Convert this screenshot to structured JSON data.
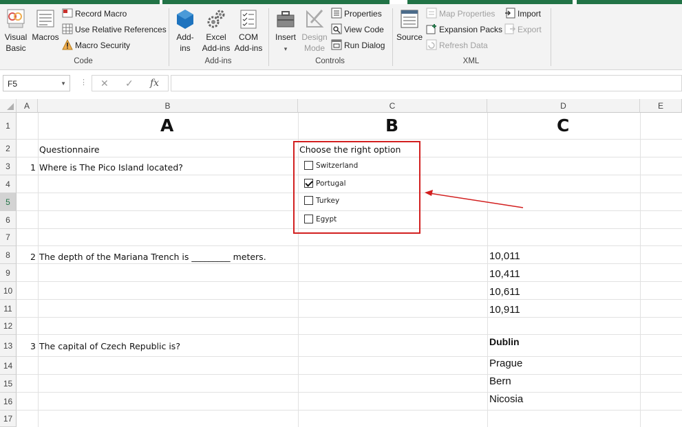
{
  "ribbon": {
    "code": {
      "group_label": "Code",
      "visual_basic_line1": "Visual",
      "visual_basic_line2": "Basic",
      "macros": "Macros",
      "record_macro": "Record Macro",
      "use_relative_references": "Use Relative References",
      "macro_security": "Macro Security"
    },
    "addins": {
      "group_label": "Add-ins",
      "addins_line1": "Add-",
      "addins_line2": "ins",
      "excel_addins_line1": "Excel",
      "excel_addins_line2": "Add-ins",
      "com_addins_line1": "COM",
      "com_addins_line2": "Add-ins"
    },
    "controls": {
      "group_label": "Controls",
      "insert": "Insert",
      "design_mode_line1": "Design",
      "design_mode_line2": "Mode",
      "properties": "Properties",
      "view_code": "View Code",
      "run_dialog": "Run Dialog"
    },
    "xml": {
      "group_label": "XML",
      "source": "Source",
      "map_properties": "Map Properties",
      "expansion_packs": "Expansion Packs",
      "refresh_data": "Refresh Data",
      "import": "Import",
      "export": "Export"
    }
  },
  "formula_bar": {
    "name_box": "F5",
    "formula": ""
  },
  "columns": [
    "A",
    "B",
    "C",
    "D",
    "E"
  ],
  "rows": [
    "1",
    "2",
    "3",
    "4",
    "5",
    "6",
    "7",
    "8",
    "9",
    "10",
    "11",
    "12",
    "13",
    "14",
    "15",
    "16",
    "17"
  ],
  "selected_row": "5",
  "sheet": {
    "header_a": "A",
    "header_b": "B",
    "header_c": "C",
    "questionnaire": "Questionnaire",
    "q1_num": "1",
    "q1_text": "Where is The Pico Island located?",
    "choose_option": "Choose the right option",
    "options": [
      {
        "label": "Switzerland",
        "checked": false
      },
      {
        "label": "Portugal",
        "checked": true
      },
      {
        "label": "Turkey",
        "checked": false
      },
      {
        "label": "Egypt",
        "checked": false
      }
    ],
    "q2_num": "2",
    "q2_text": "The depth of the Mariana Trench is _________ meters.",
    "q2_answers": [
      "10,011",
      "10,411",
      "10,611",
      "10,911"
    ],
    "q3_num": "3",
    "q3_text": "The capital of Czech Republic is?",
    "q3_answers": [
      "Dublin",
      "Prague",
      "Bern",
      "Nicosia"
    ]
  },
  "colors": {
    "accent": "#217346",
    "annotation": "#d21f1f"
  }
}
